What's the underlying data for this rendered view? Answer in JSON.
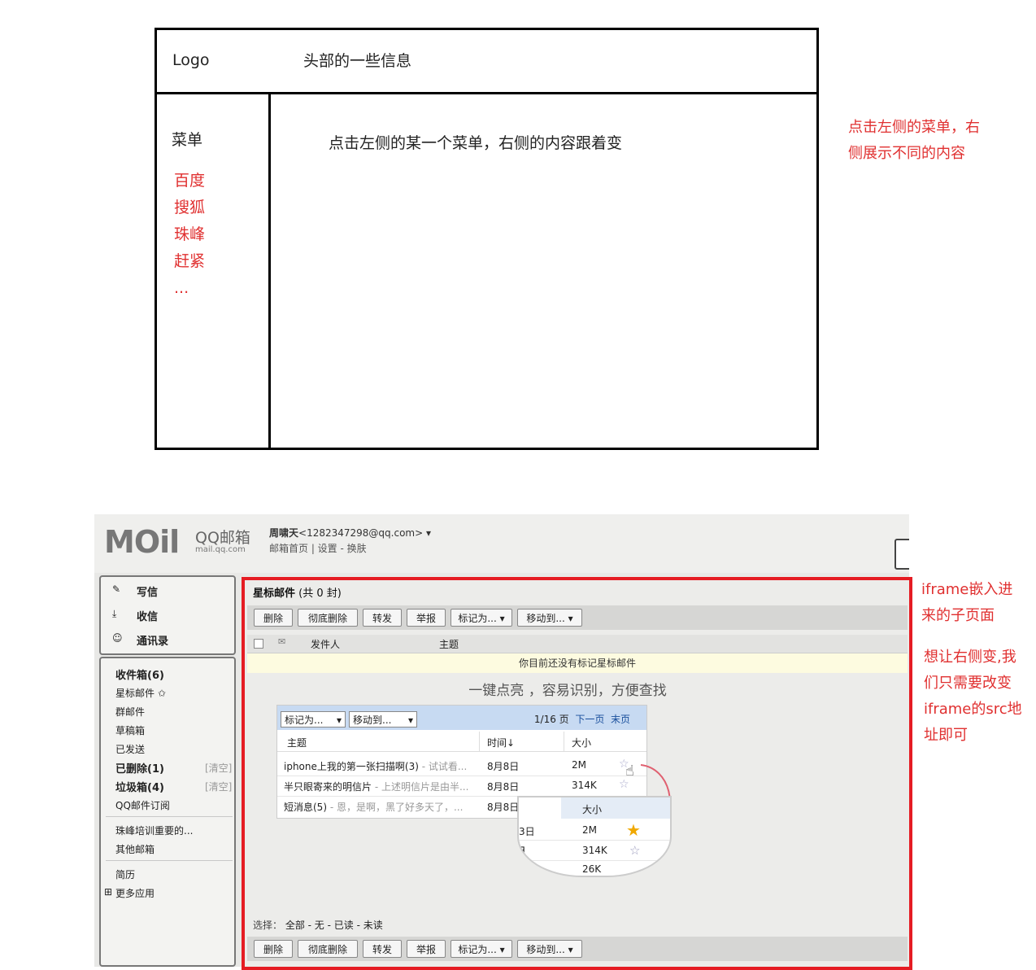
{
  "wireframe": {
    "logo": "Logo",
    "header_info": "头部的一些信息",
    "menu_label": "菜单",
    "menu_items": [
      "百度",
      "搜狐",
      "珠峰",
      "赶紧",
      "..."
    ],
    "content_text": "点击左侧的某一个菜单，右侧的内容跟着变",
    "annotation": [
      "点击左侧的菜单，右",
      "侧展示不同的内容"
    ]
  },
  "qqmail": {
    "logo_text": "MOil",
    "logo_qq": "QQ邮箱",
    "logo_sub": "mail.qq.com",
    "user_name": "周啸天",
    "user_email": "<1282347298@qq.com>",
    "user_links": "邮箱首页 | 设置 - 换肤",
    "left": {
      "write": "写信",
      "receive": "收信",
      "contacts": "通讯录",
      "inbox": "收件箱(6)",
      "starred": "星标邮件",
      "group": "群邮件",
      "drafts": "草稿箱",
      "sent": "已发送",
      "deleted": "已删除(1)",
      "junk": "垃圾箱(4)",
      "clear": "[清空]",
      "subscribe": "QQ邮件订阅",
      "folder1": "珠峰培训重要的...",
      "other": "其他邮箱",
      "resume": "简历",
      "more_apps": "更多应用"
    },
    "right": {
      "title": "星标邮件",
      "title_count": "(共 0 封)",
      "buttons": [
        "删除",
        "彻底删除",
        "转发",
        "举报",
        "标记为...",
        "移动到..."
      ],
      "col_sender": "发件人",
      "col_subject": "主题",
      "notice": "你目前还没有标记星标邮件",
      "slogan": "一键点亮 ，容易识别，方便查找",
      "demo_mark": "标记为...",
      "demo_move": "移动到...",
      "demo_page": "1/16 页",
      "demo_next": "下一页",
      "demo_last": "末页",
      "demo_col_subject": "主题",
      "demo_col_time": "时间↓",
      "demo_col_size": "大小",
      "rows": [
        {
          "subject": "iphone上我的第一张扫描啊(3)",
          "preview": " - 试试看...",
          "time": "8月8日",
          "size": "2M"
        },
        {
          "subject": "半只眼寄来的明信片",
          "preview": " - 上述明信片是由半...",
          "time": "8月8日",
          "size": "314K"
        },
        {
          "subject": "短消息(5)",
          "preview": " - 恩，是啊，黑了好多天了，...",
          "time": "8月8日",
          "size": ""
        }
      ],
      "zoom_col": "大小",
      "zoom_rows": [
        {
          "t": "3日",
          "s": "2M"
        },
        {
          "t": "∃",
          "s": "314K"
        },
        {
          "t": "",
          "s": "26K"
        }
      ],
      "select_label": "选择：",
      "select_opts": "全部 - 无 - 已读 - 未读"
    }
  },
  "annotations": {
    "iframe_note": [
      "iframe嵌入进",
      "来的子页面"
    ],
    "src_note": [
      "想让右侧变,我",
      "们只需要改变",
      "iframe的src地",
      "址即可"
    ]
  },
  "colors": {
    "accent_red": "#e51c23",
    "annotation_red": "#e03030",
    "demo_blue": "#c7daf2"
  }
}
